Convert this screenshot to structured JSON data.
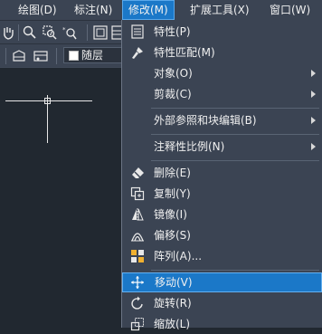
{
  "menubar": {
    "items": [
      {
        "label": "绘图(D)"
      },
      {
        "label": "标注(N)"
      },
      {
        "label": "修改(M)"
      },
      {
        "label": "扩展工具(X)"
      },
      {
        "label": "窗口(W)"
      }
    ]
  },
  "toolbar": {
    "layer_label": "随层",
    "layer_color": "#ffffff"
  },
  "menu": {
    "items": [
      {
        "label": "特性(P)",
        "icon": "properties-icon"
      },
      {
        "label": "特性匹配(M)",
        "icon": "match-properties-brush-icon"
      },
      {
        "label": "对象(O)",
        "submenu": true
      },
      {
        "label": "剪裁(C)",
        "submenu": true
      },
      {
        "label": "外部参照和块编辑(B)",
        "submenu": true
      },
      {
        "label": "注释性比例(N)",
        "submenu": true
      },
      {
        "label": "删除(E)",
        "icon": "eraser-icon"
      },
      {
        "label": "复制(Y)",
        "icon": "copy-icon"
      },
      {
        "label": "镜像(I)",
        "icon": "mirror-icon"
      },
      {
        "label": "偏移(S)",
        "icon": "offset-icon"
      },
      {
        "label": "阵列(A)...",
        "icon": "array-icon"
      },
      {
        "label": "移动(V)",
        "icon": "move-icon",
        "highlighted": true
      },
      {
        "label": "旋转(R)",
        "icon": "rotate-icon"
      },
      {
        "label": "缩放(L)",
        "icon": "scale-icon"
      }
    ]
  },
  "colors": {
    "menubar_bg": "#3b4453",
    "highlight": "#1b78c8",
    "canvas_bg": "#212830"
  }
}
